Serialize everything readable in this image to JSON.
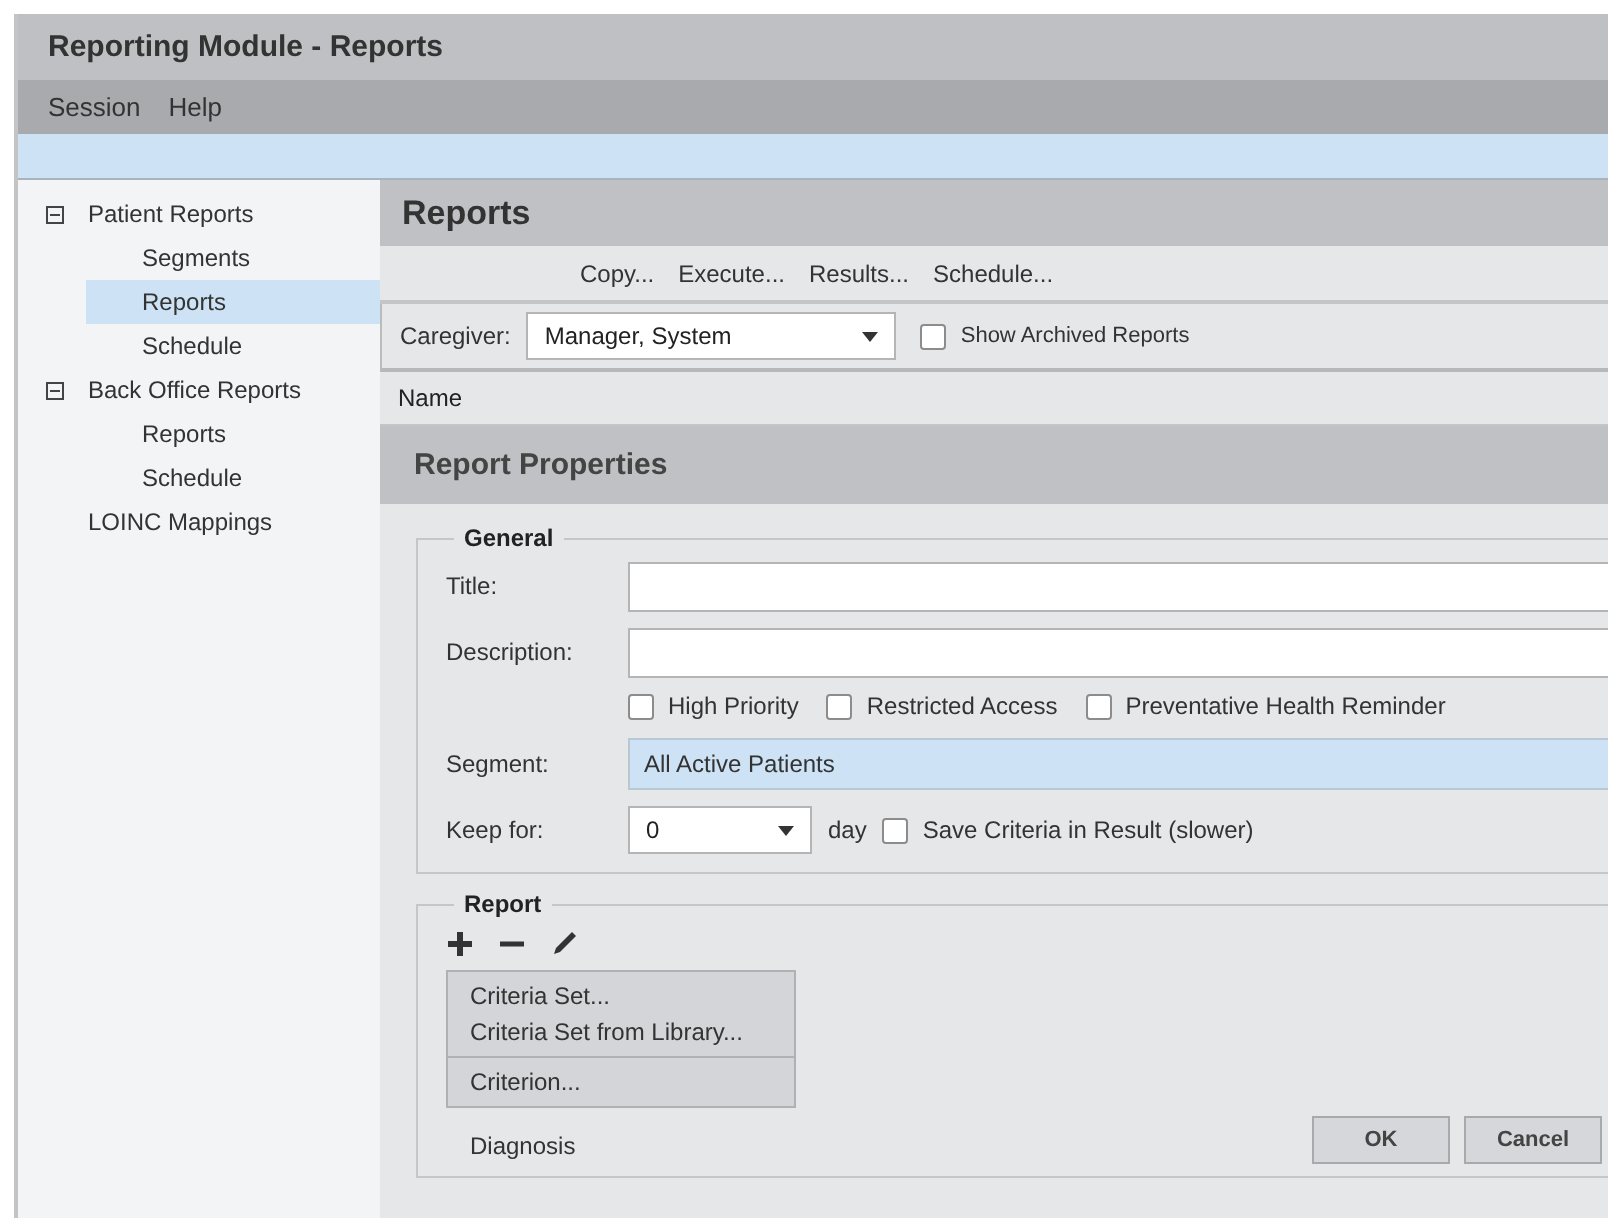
{
  "window": {
    "title": "Reporting Module - Reports"
  },
  "menu": [
    "Session",
    "Help"
  ],
  "sidebar": {
    "items": [
      {
        "label": "Patient Reports",
        "selected": false,
        "expanded": true,
        "children": [
          {
            "label": "Segments",
            "selected": false
          },
          {
            "label": "Reports",
            "selected": true
          },
          {
            "label": "Schedule",
            "selected": false
          }
        ]
      },
      {
        "label": "Back Office Reports",
        "selected": false,
        "expanded": true,
        "children": [
          {
            "label": "Reports",
            "selected": false
          },
          {
            "label": "Schedule",
            "selected": false
          }
        ]
      },
      {
        "label": "LOINC Mappings",
        "selected": false
      }
    ]
  },
  "main": {
    "title": "Reports",
    "toolbar": [
      "Copy...",
      "Execute...",
      "Results...",
      "Schedule..."
    ],
    "caregiver": {
      "label": "Caregiver:",
      "value": "Manager, System"
    },
    "show_archived": {
      "label": "Show Archived Reports",
      "checked": false
    },
    "list_header": "Name"
  },
  "properties": {
    "title": "Report Properties",
    "general": {
      "legend": "General",
      "title_label": "Title:",
      "description_label": "Description:",
      "flags": [
        {
          "label": "High Priority",
          "checked": false
        },
        {
          "label": "Restricted Access",
          "checked": false
        },
        {
          "label": "Preventative Health Reminder",
          "checked": false
        }
      ],
      "segment_label": "Segment:",
      "segment_value": "All Active Patients",
      "keep_label": "Keep for:",
      "keep_value": "0",
      "keep_unit": "day",
      "save_criteria": {
        "label": "Save Criteria in Result (slower)",
        "checked": false
      }
    },
    "report": {
      "legend": "Report",
      "menu_groups": [
        [
          "Criteria Set...",
          "Criteria Set from Library..."
        ],
        [
          "Criterion..."
        ]
      ],
      "item": "Diagnosis"
    },
    "buttons": [
      "OK",
      "Cancel"
    ]
  }
}
